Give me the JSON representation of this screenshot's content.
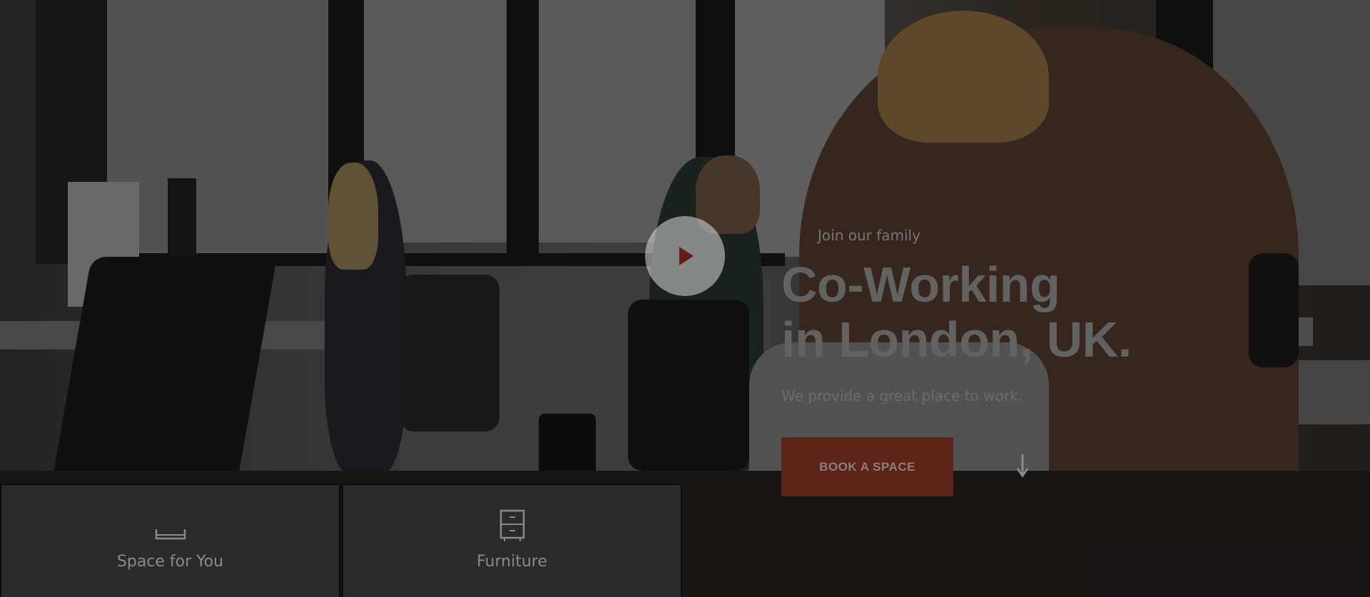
{
  "hero": {
    "play_button_icon": "play-icon",
    "eyebrow": "Join our family",
    "headline_line1": "Co-Working",
    "headline_line2": "in London, UK.",
    "subtext": "We provide a great place to work.",
    "cta_label": "BOOK A SPACE",
    "scroll_icon": "arrow-down-icon",
    "colors": {
      "accent": "#a11c0c",
      "cta_background": "#5c2418",
      "overlay": "rgba(0,0,0,0.42)"
    }
  },
  "features": [
    {
      "icon": "bed-icon",
      "label": "Space for You"
    },
    {
      "icon": "cabinet-icon",
      "label": "Furniture"
    }
  ]
}
